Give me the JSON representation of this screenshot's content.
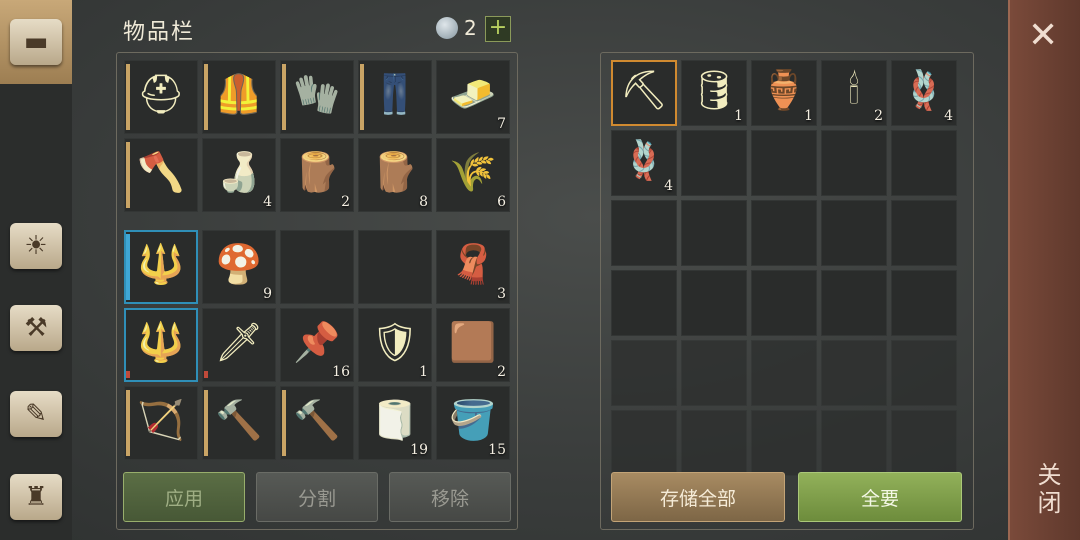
{
  "sidebar": {
    "tabs": [
      {
        "icon": "chest-icon"
      },
      {
        "icon": "sun-book-icon"
      },
      {
        "icon": "hammer-map-icon"
      },
      {
        "icon": "scroll-quill-icon"
      },
      {
        "icon": "backpack-icon"
      }
    ]
  },
  "inventory": {
    "title": "物品栏",
    "gem_count": "2",
    "plus": "+",
    "equipment": [
      {
        "name": "helmet",
        "icon": "⛑",
        "count": "",
        "bar": "tan"
      },
      {
        "name": "chainmail",
        "icon": "🦺",
        "count": "",
        "bar": "tan"
      },
      {
        "name": "gloves",
        "icon": "🧤",
        "count": "",
        "bar": "tan"
      },
      {
        "name": "pants",
        "icon": "👖",
        "count": "",
        "bar": "tan"
      },
      {
        "name": "gold-ingot",
        "icon": "🧈",
        "count": "7",
        "bar": ""
      },
      {
        "name": "axe",
        "icon": "🪓",
        "count": "",
        "bar": "tan"
      },
      {
        "name": "bottle",
        "icon": "🍶",
        "count": "4",
        "bar": ""
      },
      {
        "name": "birch-log",
        "icon": "🪵",
        "count": "2",
        "bar": ""
      },
      {
        "name": "log",
        "icon": "🪵",
        "count": "8",
        "bar": ""
      },
      {
        "name": "fiber",
        "icon": "🌾",
        "count": "6",
        "bar": ""
      }
    ],
    "backpack": [
      {
        "name": "halberd",
        "icon": "🔱",
        "count": "",
        "bar": "blue",
        "selected": true
      },
      {
        "name": "mushrooms",
        "icon": "🍄",
        "count": "9",
        "bar": ""
      },
      {
        "name": "empty",
        "icon": "",
        "count": "",
        "bar": ""
      },
      {
        "name": "empty",
        "icon": "",
        "count": "",
        "bar": ""
      },
      {
        "name": "fabric",
        "icon": "🧣",
        "count": "3",
        "bar": ""
      },
      {
        "name": "halberd",
        "icon": "🔱",
        "count": "",
        "bar": "red",
        "selected": true
      },
      {
        "name": "sword",
        "icon": "🗡",
        "count": "",
        "bar": "red"
      },
      {
        "name": "nails",
        "icon": "📌",
        "count": "16",
        "bar": ""
      },
      {
        "name": "shield",
        "icon": "🛡",
        "count": "1",
        "bar": ""
      },
      {
        "name": "leather",
        "icon": "🟫",
        "count": "2",
        "bar": ""
      },
      {
        "name": "crossbow",
        "icon": "🏹",
        "count": "",
        "bar": "tan"
      },
      {
        "name": "mace",
        "icon": "🔨",
        "count": "",
        "bar": "tan"
      },
      {
        "name": "mace",
        "icon": "🔨",
        "count": "",
        "bar": "tan"
      },
      {
        "name": "bandage",
        "icon": "🧻",
        "count": "19",
        "bar": ""
      },
      {
        "name": "berry-bucket",
        "icon": "🪣",
        "count": "15",
        "bar": ""
      }
    ],
    "buttons": {
      "apply": "应用",
      "split": "分割",
      "remove": "移除"
    }
  },
  "storage": {
    "items": [
      {
        "name": "pickaxe",
        "icon": "⛏",
        "count": "",
        "selected": true
      },
      {
        "name": "barrel",
        "icon": "🛢",
        "count": "1"
      },
      {
        "name": "water-flask",
        "icon": "🏺",
        "count": "1"
      },
      {
        "name": "candle",
        "icon": "🕯",
        "count": "2"
      },
      {
        "name": "rope-knot",
        "icon": "🪢",
        "count": "4"
      },
      {
        "name": "rope",
        "icon": "🪢",
        "count": "4"
      }
    ],
    "buttons": {
      "store_all": "存储全部",
      "take_all": "全要"
    }
  },
  "close": {
    "label": "关闭",
    "x": "✕"
  }
}
